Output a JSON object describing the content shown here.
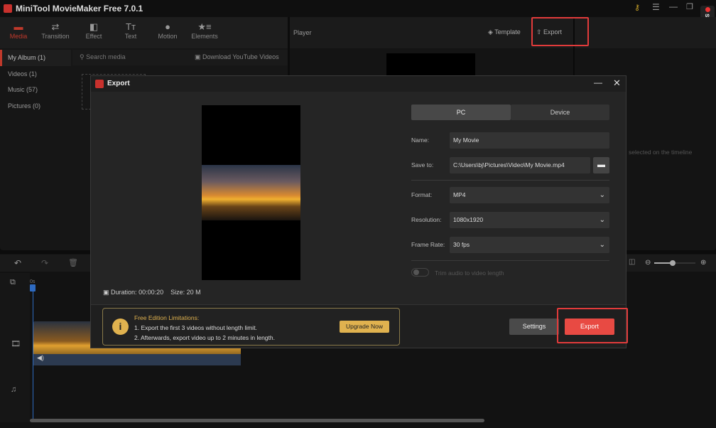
{
  "app": {
    "title": "MiniTool MovieMaker Free 7.0.1"
  },
  "toolbar": {
    "tabs": [
      {
        "label": "Media",
        "icon": "folder-icon"
      },
      {
        "label": "Transition",
        "icon": "arrows-icon"
      },
      {
        "label": "Effect",
        "icon": "effect-icon"
      },
      {
        "label": "Text",
        "icon": "text-icon"
      },
      {
        "label": "Motion",
        "icon": "motion-icon"
      },
      {
        "label": "Elements",
        "icon": "elements-icon"
      }
    ]
  },
  "sidebar": {
    "items": [
      {
        "label": "My Album (1)"
      },
      {
        "label": "Videos (1)"
      },
      {
        "label": "Music (57)"
      },
      {
        "label": "Pictures (0)"
      }
    ]
  },
  "media": {
    "search_placeholder": "Search media",
    "download_label": "Download YouTube Videos"
  },
  "player": {
    "label": "Player",
    "template_label": "Template",
    "export_label": "Export",
    "hint": "selected on the timeline"
  },
  "watermark": "screenrec",
  "timeline": {
    "playhead": "0s"
  },
  "export": {
    "title": "Export",
    "tabs": [
      "PC",
      "Device"
    ],
    "name_label": "Name:",
    "name_value": "My Movie",
    "save_label": "Save to:",
    "save_value": "C:\\Users\\bj\\Pictures\\Video\\My Movie.mp4",
    "format_label": "Format:",
    "format_value": "MP4",
    "resolution_label": "Resolution:",
    "resolution_value": "1080x1920",
    "framerate_label": "Frame Rate:",
    "framerate_value": "30 fps",
    "trim_label": "Trim audio to video length",
    "duration_label": "Duration:",
    "duration_value": "00:00:20",
    "size_label": "Size:",
    "size_value": "20 M",
    "notice_title": "Free Edition Limitations:",
    "notice_line1": "1. Export the first 3 videos without length limit.",
    "notice_line2": "2. Afterwards, export video up to 2 minutes in length.",
    "upgrade_label": "Upgrade Now",
    "settings_label": "Settings",
    "export_label": "Export"
  },
  "colors": {
    "accent": "#e84a43",
    "gold": "#e0b24f",
    "highlight": "#e23b3b"
  }
}
